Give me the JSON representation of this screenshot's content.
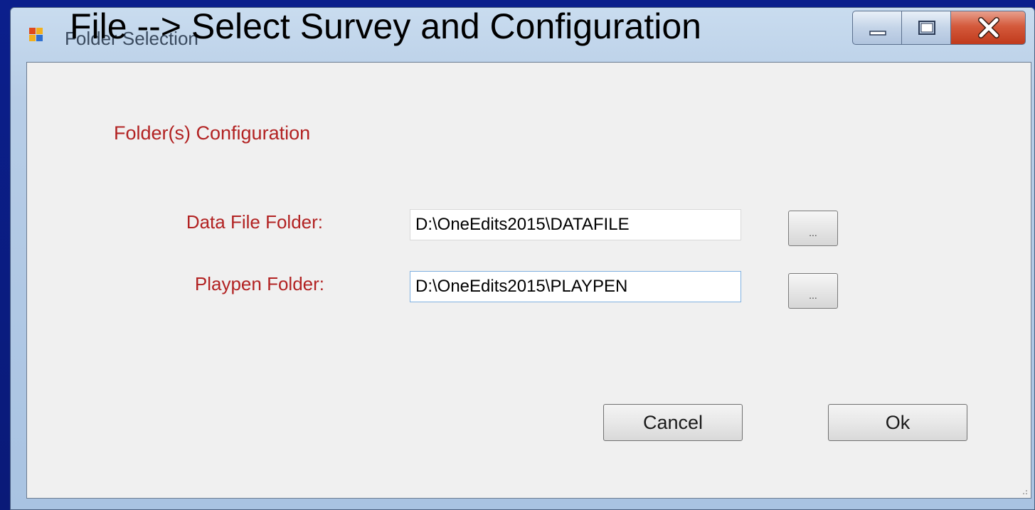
{
  "slide": {
    "title": "File --> Select Survey and Configuration"
  },
  "window": {
    "title": "Folder Selection",
    "icon": "app-window-icon",
    "controls": {
      "minimize_icon": "minimize-icon",
      "maximize_icon": "maximize-icon",
      "close_icon": "close-icon"
    }
  },
  "form": {
    "group_label": "Folder(s) Configuration",
    "fields": [
      {
        "label": "Data File Folder:",
        "value": "D:\\OneEdits2015\\DATAFILE",
        "browse_label": "..."
      },
      {
        "label": "Playpen Folder:",
        "value": "D:\\OneEdits2015\\PLAYPEN",
        "browse_label": "..."
      }
    ],
    "buttons": {
      "cancel": "Cancel",
      "ok": "Ok"
    }
  },
  "colors": {
    "label_red": "#b22222",
    "slide_background": "#0a1a7a",
    "close_button": "#c03a1c"
  }
}
